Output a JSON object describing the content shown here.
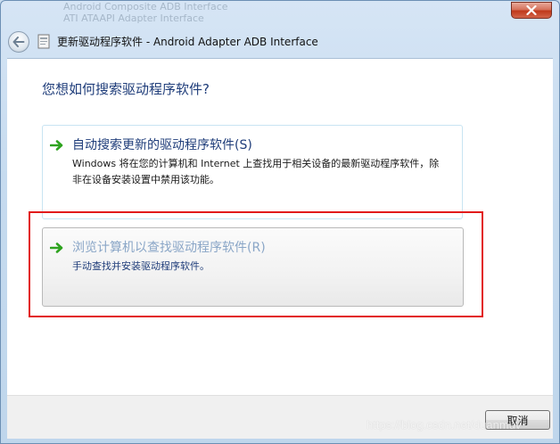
{
  "window": {
    "title": "更新驱动程序软件 - Android Adapter ADB Interface",
    "close_label": "×"
  },
  "background_ghost": {
    "line1": "Android Composite ADB Interface",
    "line2": "ATI ATAAPI Adapter Interface"
  },
  "content": {
    "question": "您想如何搜索驱动程序软件?",
    "options": [
      {
        "title": "自动搜索更新的驱动程序软件(S)",
        "description": "Windows 将在您的计算机和 Internet 上查找用于相关设备的最新驱动程序软件，除非在设备安装设置中禁用该功能。",
        "icon": "green-arrow-icon"
      },
      {
        "title": "浏览计算机以查找驱动程序软件(R)",
        "description": "手动查找并安装驱动程序软件。",
        "icon": "green-arrow-icon"
      }
    ]
  },
  "footer": {
    "cancel_label": "取消"
  },
  "watermark": "https://blog.csdn.net/duanmuv",
  "colors": {
    "heading": "#1f3d7a",
    "highlight_box": "#e21b1b",
    "arrow_green": "#2ea31f"
  }
}
